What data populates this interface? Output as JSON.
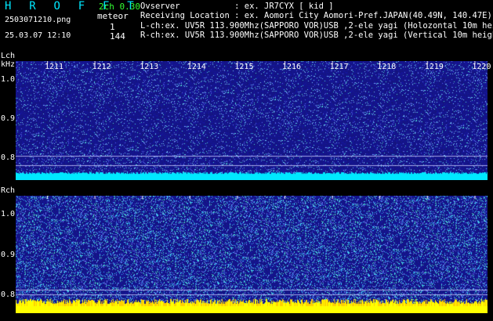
{
  "header": {
    "app_title": "H R O F F T",
    "version": "2ch 0.30",
    "filename": "2503071210.png",
    "datetime": "25.03.07 12:10",
    "meteor_label": "meteor",
    "meteor_l": "1",
    "meteor_r": "144",
    "observer": "Ovserver           : ex. JR7CYX [ kid ]",
    "location": "Receiving Location : ex. Aomori City Aomori-Pref.JAPAN(40.49N, 140.47E)",
    "l_ch": "L-ch:ex. UV5R 113.900Mhz(SAPPORO VOR)USB ,2-ele yagi (Holozontal 10m height)",
    "r_ch": "R-ch:ex. UV5R 113.900Mhz(SAPPORO VOR)USB ,2-ele yagi (Vertical 10m height)"
  },
  "axes": {
    "l_label": "Lch",
    "unit": "kHz",
    "r_label": "Rch",
    "y_ticks_l": [
      "1.0",
      "0.9",
      "0.8"
    ],
    "y_ticks_r": [
      "1.0",
      "0.9",
      "0.8"
    ],
    "x_ticks": [
      "1211",
      "1212",
      "1213",
      "1214",
      "1215",
      "1216",
      "1217",
      "1218",
      "1219",
      "1220"
    ]
  },
  "colors": {
    "background": "#000000",
    "header_text": "#00e8ff",
    "meta_text": "#ffffff",
    "counter_text": "#33ff33",
    "lch_trace": "#00e8ff",
    "rch_trace": "#ffff00"
  }
}
